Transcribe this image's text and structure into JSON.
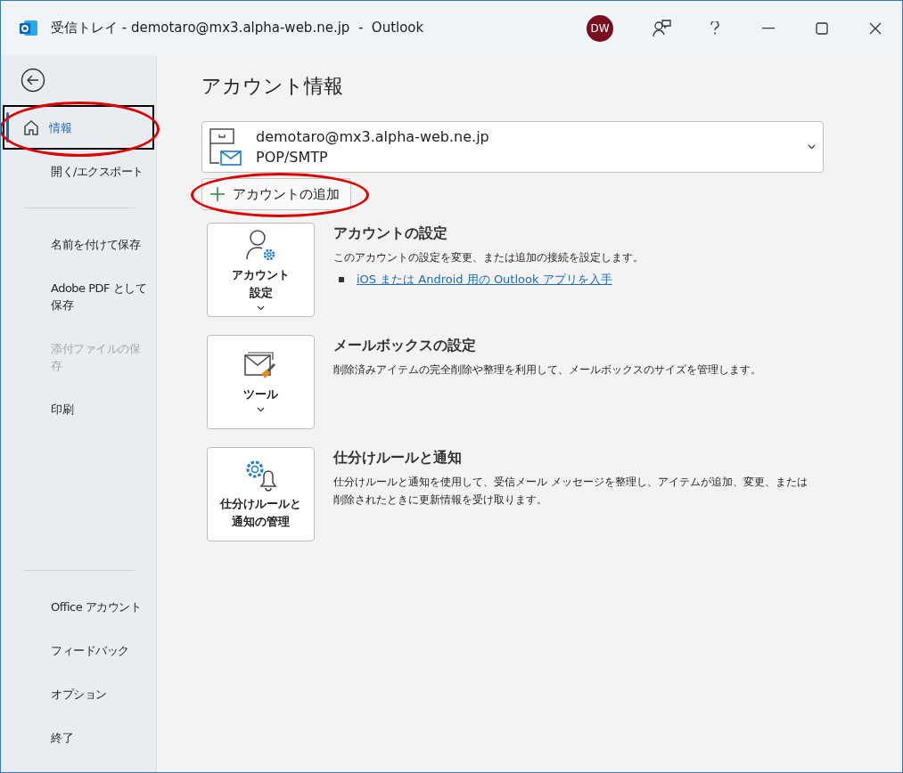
{
  "window": {
    "title": "受信トレイ - demotaro@mx3.alpha-web.ne.jp  -  Outlook",
    "avatar": "DW"
  },
  "sidebar": {
    "items": [
      {
        "kind": "item",
        "label": "情報",
        "selected": true,
        "disabled": false,
        "highlighted": true
      },
      {
        "kind": "item",
        "label": "開く/エクスポート",
        "selected": false,
        "disabled": false,
        "highlighted": false
      },
      {
        "kind": "divider"
      },
      {
        "kind": "item",
        "label": "名前を付けて保存",
        "selected": false,
        "disabled": false,
        "highlighted": false
      },
      {
        "kind": "item",
        "label": "Adobe PDF として保存",
        "selected": false,
        "disabled": false,
        "highlighted": false
      },
      {
        "kind": "item",
        "label": "添付ファイルの保存",
        "selected": false,
        "disabled": true,
        "highlighted": false
      },
      {
        "kind": "item",
        "label": "印刷",
        "selected": false,
        "disabled": false,
        "highlighted": false
      }
    ],
    "bottom_items": [
      {
        "kind": "divider"
      },
      {
        "kind": "item",
        "label": "Office アカウント",
        "selected": false,
        "disabled": false,
        "highlighted": false
      },
      {
        "kind": "item",
        "label": "フィードバック",
        "selected": false,
        "disabled": false,
        "highlighted": false
      },
      {
        "kind": "item",
        "label": "オプション",
        "selected": false,
        "disabled": false,
        "highlighted": false
      },
      {
        "kind": "item",
        "label": "終了",
        "selected": false,
        "disabled": false,
        "highlighted": false
      }
    ]
  },
  "main": {
    "title": "アカウント情報",
    "account": {
      "email": "demotaro@mx3.alpha-web.ne.jp",
      "type": "POP/SMTP"
    },
    "add_account": {
      "label": "アカウントの追加",
      "highlighted": true
    },
    "sections": [
      {
        "kind": "account",
        "button": [
          "アカウント",
          "設定"
        ],
        "dropdown": true,
        "title": "アカウントの設定",
        "description": "このアカウントの設定を変更、または追加の接続を設定します。",
        "link": "iOS または Android 用の Outlook アプリを入手"
      },
      {
        "kind": "tools",
        "button": [
          "ツール"
        ],
        "dropdown": true,
        "title": "メールボックスの設定",
        "description": "削除済みアイテムの完全削除や整理を利用して、メールボックスのサイズを管理します。"
      },
      {
        "kind": "rules",
        "button": [
          "仕分けルールと",
          "通知の管理"
        ],
        "dropdown": false,
        "title": "仕分けルールと通知",
        "description": "仕分けルールと通知を使用して、受信メール メッセージを整理し、アイテムが追加、変更、または削除されたときに更新情報を受け取ります。"
      }
    ]
  }
}
